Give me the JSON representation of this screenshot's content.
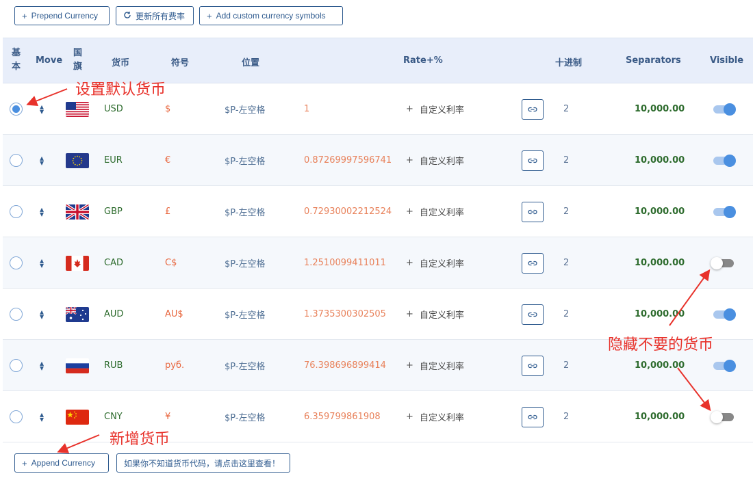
{
  "toolbar": {
    "prepend": "Prepend Currency",
    "update": "更新所有费率",
    "add_symbols": "Add custom currency symbols"
  },
  "headers": {
    "basic": "基本",
    "move": "Move",
    "flag": "国旗",
    "currency": "货币",
    "symbol": "符号",
    "position": "位置",
    "rate": "Rate+%",
    "decimal": "十进制",
    "separators": "Separators",
    "visible": "Visible"
  },
  "rows": [
    {
      "code": "USD",
      "symbol": "$",
      "position": "$P-左空格",
      "rate": "1",
      "plus": "+",
      "custom": "自定义利率",
      "decimal": "2",
      "separators": "10,000.00",
      "visible": true,
      "default": true,
      "flag": "us"
    },
    {
      "code": "EUR",
      "symbol": "€",
      "position": "$P-左空格",
      "rate": "0.87269997596741",
      "plus": "+",
      "custom": "自定义利率",
      "decimal": "2",
      "separators": "10,000.00",
      "visible": true,
      "default": false,
      "flag": "eu"
    },
    {
      "code": "GBP",
      "symbol": "£",
      "position": "$P-左空格",
      "rate": "0.72930002212524",
      "plus": "+",
      "custom": "自定义利率",
      "decimal": "2",
      "separators": "10,000.00",
      "visible": true,
      "default": false,
      "flag": "gb"
    },
    {
      "code": "CAD",
      "symbol": "C$",
      "position": "$P-左空格",
      "rate": "1.2510099411011",
      "plus": "+",
      "custom": "自定义利率",
      "decimal": "2",
      "separators": "10,000.00",
      "visible": false,
      "default": false,
      "flag": "ca"
    },
    {
      "code": "AUD",
      "symbol": "AU$",
      "position": "$P-左空格",
      "rate": "1.3735300302505",
      "plus": "+",
      "custom": "自定义利率",
      "decimal": "2",
      "separators": "10,000.00",
      "visible": true,
      "default": false,
      "flag": "au"
    },
    {
      "code": "RUB",
      "symbol": "руб.",
      "position": "$P-左空格",
      "rate": "76.398696899414",
      "plus": "+",
      "custom": "自定义利率",
      "decimal": "2",
      "separators": "10,000.00",
      "visible": true,
      "default": false,
      "flag": "ru"
    },
    {
      "code": "CNY",
      "symbol": "¥",
      "position": "$P-左空格",
      "rate": "6.359799861908",
      "plus": "+",
      "custom": "自定义利率",
      "decimal": "2",
      "separators": "10,000.00",
      "visible": false,
      "default": false,
      "flag": "cn"
    }
  ],
  "footer": {
    "append": "Append Currency",
    "lookup": "如果你不知道货币代码，请点击这里查看！"
  },
  "annotations": {
    "default_currency": "设置默认货币",
    "hide_currency": "隐藏不要的货币",
    "add_currency": "新增货币"
  },
  "colors": {
    "accent": "#2f5b8f",
    "annotation": "#e8322b",
    "code": "#2d6b2d",
    "rate": "#e8815a"
  }
}
